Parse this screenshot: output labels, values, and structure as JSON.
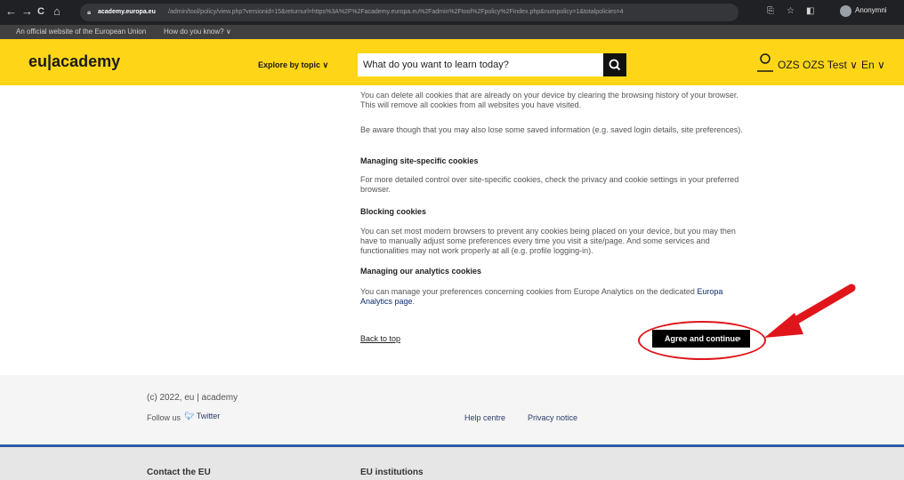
{
  "browser": {
    "back_icon": "←",
    "forward_icon": "→",
    "reload_icon": "C",
    "home_icon": "⌂",
    "url_domain": "academy.europa.eu",
    "url_path": "/admin/tool/policy/view.php?versionid=15&returnurl=https%3A%2F%2Facademy.europa.eu%2Fadmin%2Ftool%2Fpolicy%2Findex.php&numpolicy=1&totalpolicies=4",
    "profile_label": "Anonymni"
  },
  "eu_banner": {
    "text": "An official website of the European Union",
    "link": "How do you know? ∨"
  },
  "header": {
    "logo": "eu|academy",
    "explore": "Explore by topic ∨",
    "search_placeholder": "What do you want to learn today?",
    "user_name": "OZS OZS Test ∨",
    "language": "En ∨",
    "accent_color": "#ffd617"
  },
  "content": {
    "p1": "You can delete all cookies that are already on your device by clearing the browsing history of your browser. This will remove all cookies from all websites you have visited.",
    "p2": "Be aware though that you may also lose some saved information (e.g. saved login details, site preferences).",
    "h1": "Managing site-specific cookies",
    "p3": "For more detailed control over site-specific cookies, check the privacy and cookie settings in your preferred browser.",
    "h2": "Blocking cookies",
    "p4": "You can set most modern browsers to prevent any cookies being placed on your device, but you may then have to manually adjust some preferences every time you visit a site/page. And some services and functionalities may not work properly at all (e.g. profile logging-in).",
    "h3": "Managing our analytics cookies",
    "p5_text": "You can manage your preferences concerning cookies from Europe Analytics on the dedicated ",
    "p5_link": "Europa Analytics page",
    "p5_end": ".",
    "back_to_top": "Back to top",
    "agree_button": "Agree and continue",
    "agree_chevron": "›"
  },
  "footer": {
    "copyright": "(c) 2022, eu | academy",
    "follow_us": "Follow us",
    "twitter": "Twitter",
    "help_centre": "Help centre",
    "privacy_notice": "Privacy notice",
    "contact_eu": "Contact the EU",
    "eu_institutions": "EU institutions"
  }
}
